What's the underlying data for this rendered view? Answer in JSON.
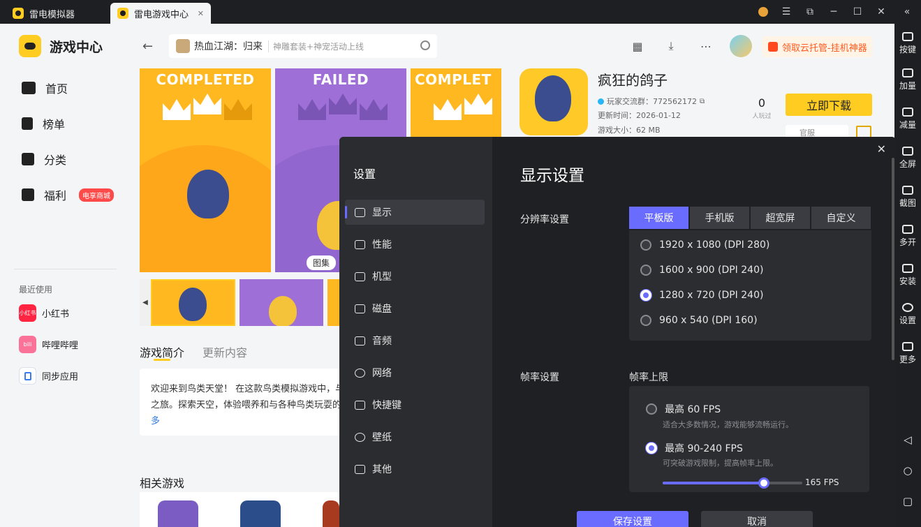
{
  "titlebar": {
    "tabs": [
      {
        "label": "雷电模拟器"
      },
      {
        "label": "雷电游戏中心"
      }
    ],
    "close_tab": "✕"
  },
  "right_toolbar": {
    "items": [
      {
        "label": "按键"
      },
      {
        "label": "加量"
      },
      {
        "label": "减量"
      },
      {
        "label": "全屏"
      },
      {
        "label": "截图"
      },
      {
        "label": "多开"
      },
      {
        "label": "安装"
      },
      {
        "label": "设置"
      },
      {
        "label": "更多"
      }
    ]
  },
  "sidebar": {
    "brand": "游戏中心",
    "nav": [
      {
        "label": "首页"
      },
      {
        "label": "榜单"
      },
      {
        "label": "分类"
      },
      {
        "label": "福利"
      }
    ],
    "welfare_badge": "电享商城",
    "recent_label": "最近使用",
    "recent": [
      {
        "label": "小红书",
        "icon_text": "小红书",
        "color": "#ff2442"
      },
      {
        "label": "哔哩哔哩",
        "icon_text": "bili",
        "color": "#fb7299"
      },
      {
        "label": "同步应用",
        "icon_text": "",
        "color": "#e8f0ff"
      }
    ]
  },
  "header": {
    "search_title": "热血江湖：归来",
    "search_sub": "神雕套装+神宠活动上线",
    "promo": "领取云托管-挂机神器"
  },
  "gallery": {
    "shots": [
      {
        "label": "COMPLETED"
      },
      {
        "label": "FAILED"
      },
      {
        "label": "COMPLET"
      }
    ],
    "pill": "图集"
  },
  "game": {
    "title": "疯狂的鸽子",
    "group": "玩家交流群：772562172",
    "updated": "更新时间：2026-01-12",
    "size": "游戏大小：62 MB",
    "players_num": "0",
    "players_label": "人玩过",
    "download": "立即下载",
    "official": "官服"
  },
  "intro": {
    "tabs": [
      {
        "label": "游戏简介"
      },
      {
        "label": "更新内容"
      }
    ],
    "lines": [
      "欢迎来到鸟类天堂！ 在这款鸟类模拟游戏中，与",
      "之旅。探索天空，体验喂养和与各种鸟类玩耍的"
    ],
    "more": "多",
    "related": "相关游戏"
  },
  "settings": {
    "title": "设置",
    "close": "✕",
    "menu": [
      {
        "label": "显示"
      },
      {
        "label": "性能"
      },
      {
        "label": "机型"
      },
      {
        "label": "磁盘"
      },
      {
        "label": "音频"
      },
      {
        "label": "网络"
      },
      {
        "label": "快捷键"
      },
      {
        "label": "壁纸"
      },
      {
        "label": "其他"
      }
    ],
    "heading": "显示设置",
    "resolution_label": "分辨率设置",
    "resolution_tabs": [
      {
        "label": "平板版"
      },
      {
        "label": "手机版"
      },
      {
        "label": "超宽屏"
      },
      {
        "label": "自定义"
      }
    ],
    "resolutions": [
      {
        "label": "1920 x 1080  (DPI 280)"
      },
      {
        "label": "1600 x 900  (DPI 240)"
      },
      {
        "label": "1280 x 720  (DPI 240)"
      },
      {
        "label": "960 x 540  (DPI 160)"
      }
    ],
    "selected_resolution": 2,
    "framerate_label": "帧率设置",
    "framerate_cap_label": "帧率上限",
    "fps_options": [
      {
        "label": "最高 60 FPS",
        "sub": "适合大多数情况，游戏能够流畅运行。"
      },
      {
        "label": "最高 90-240 FPS",
        "sub": "可突破游戏限制，提高帧率上限。"
      }
    ],
    "selected_fps": 1,
    "slider_value": "165 FPS",
    "slider_fraction": 0.725,
    "save": "保存设置",
    "cancel": "取消"
  },
  "colors": {
    "accent": "#6a6cff",
    "brand": "#ffcc22"
  }
}
